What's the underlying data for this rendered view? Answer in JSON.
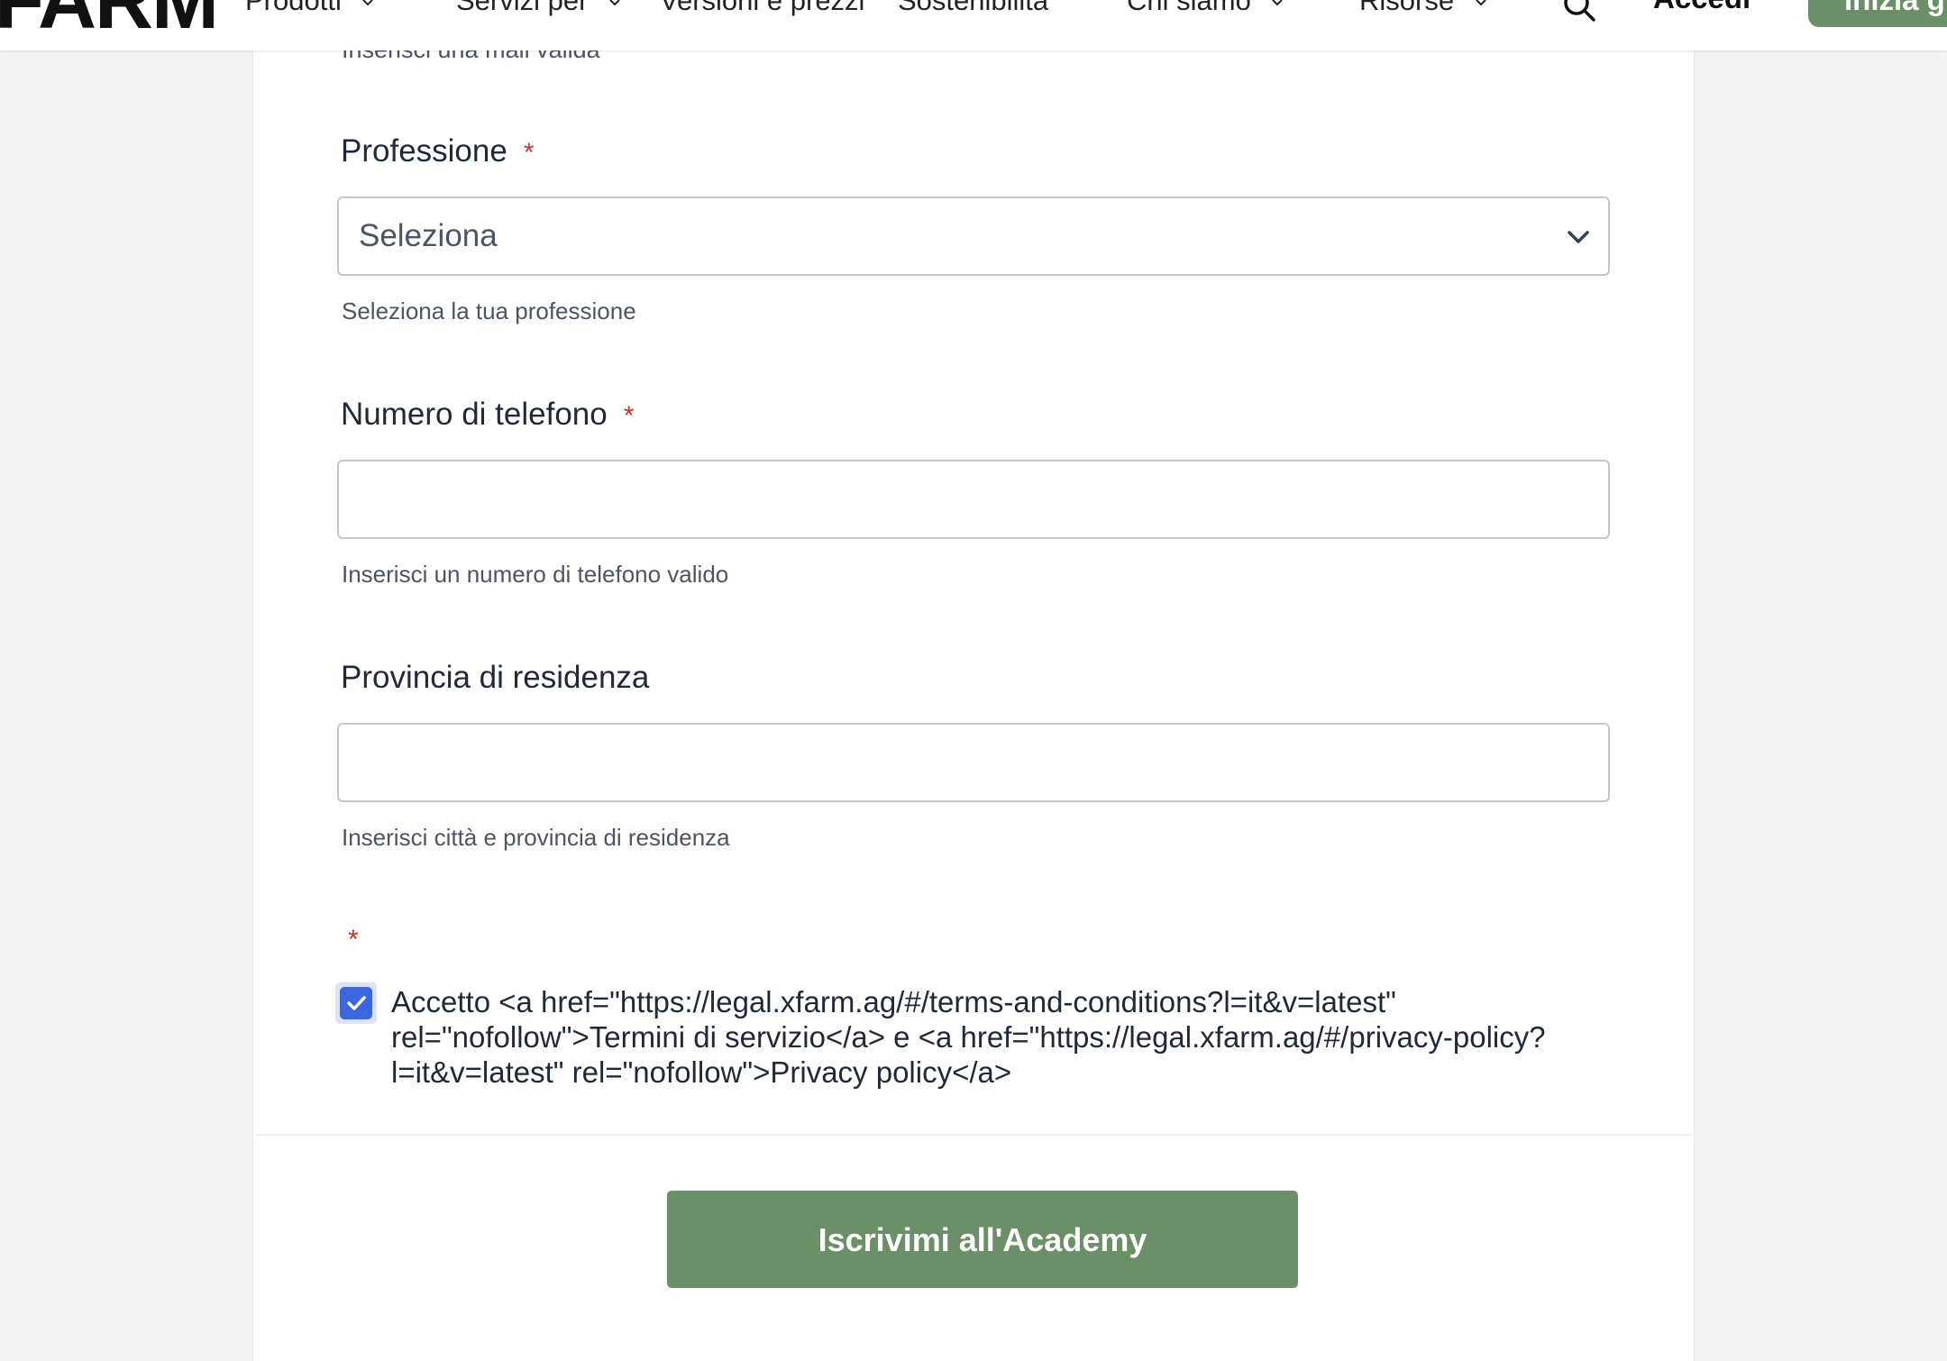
{
  "nav": {
    "logo": "FARM",
    "items": [
      {
        "label": "Prodotti",
        "has_chevron": true
      },
      {
        "label": "Servizi per",
        "has_chevron": true
      },
      {
        "label": "Versioni e prezzi",
        "has_chevron": false
      },
      {
        "label": "Sostenibilità",
        "has_chevron": false
      },
      {
        "label": "Chi siamo",
        "has_chevron": true
      },
      {
        "label": "Risorse",
        "has_chevron": true
      }
    ],
    "login_label": "Accedi",
    "cta_label": "Inizia g"
  },
  "form": {
    "email_hint": "Inserisci una mail valida",
    "profession": {
      "label": "Professione",
      "required_mark": "*",
      "selected": "Seleziona",
      "help": "Seleziona la tua professione"
    },
    "phone": {
      "label": "Numero di telefono",
      "required_mark": "*",
      "value": "",
      "help": "Inserisci un numero di telefono valido"
    },
    "province": {
      "label": "Provincia di residenza",
      "value": "",
      "help": "Inserisci città e provincia di residenza"
    },
    "consent": {
      "required_mark": "*",
      "checked": true,
      "text": "Accetto <a href=\"https://legal.xfarm.ag/#/terms-and-conditions?l=it&v=latest\" rel=\"nofollow\">Termini di servizio</a> e <a href=\"https://legal.xfarm.ag/#/privacy-policy?l=it&v=latest\" rel=\"nofollow\">Privacy policy</a>"
    },
    "submit_label": "Iscrivimi all'Academy"
  },
  "colors": {
    "brand_green": "#6b8f66",
    "checkbox_blue": "#3c66e0",
    "required_red": "#c0392b"
  }
}
